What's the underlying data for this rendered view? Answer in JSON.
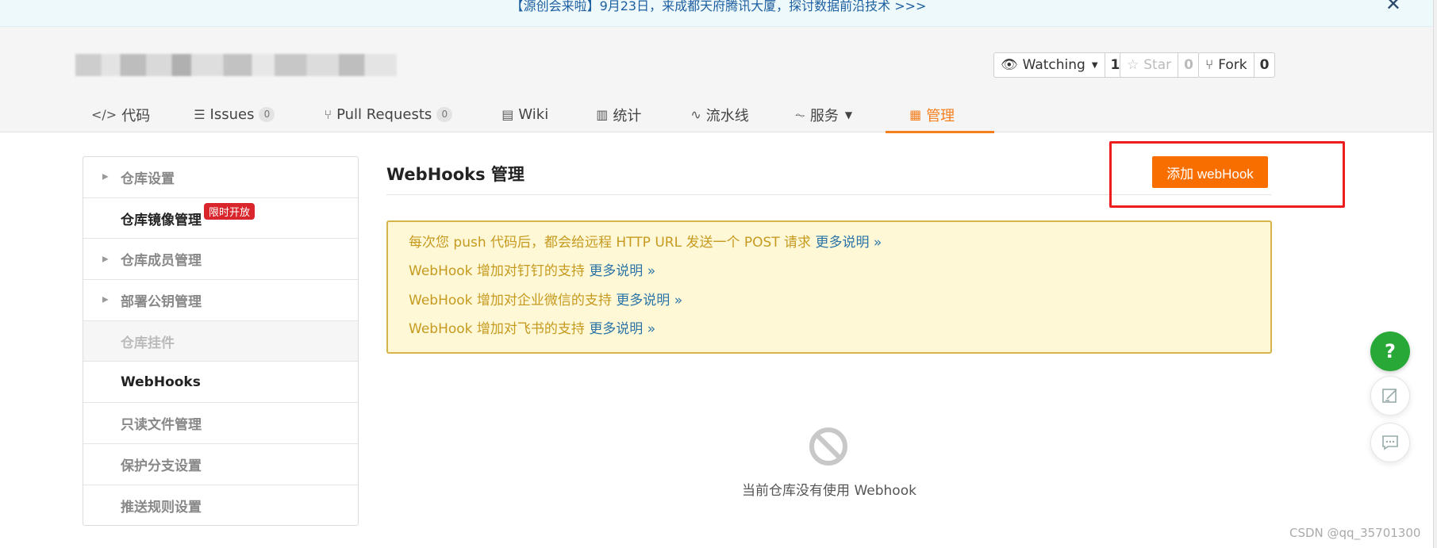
{
  "banner": {
    "text": "【源创会来啦】9月23日，来成都天府腾讯大厦，探讨数据前沿技术 >>>",
    "close_label": "✕"
  },
  "repo_actions": {
    "watch": {
      "label": "Watching",
      "count": "1"
    },
    "star": {
      "label": "Star",
      "count": "0"
    },
    "fork": {
      "label": "Fork",
      "count": "0"
    }
  },
  "tabs": [
    {
      "label": "代码",
      "icon": "</>"
    },
    {
      "label": "Issues",
      "icon": "☰",
      "badge": "0"
    },
    {
      "label": "Pull Requests",
      "icon": "⑂",
      "badge": "0"
    },
    {
      "label": "Wiki",
      "icon": "▤"
    },
    {
      "label": "统计",
      "icon": "▥"
    },
    {
      "label": "流水线",
      "icon": "∿"
    },
    {
      "label": "服务",
      "icon": "⏦"
    },
    {
      "label": "管理",
      "icon": "▦"
    }
  ],
  "sidebar": {
    "items": [
      {
        "label": "仓库设置"
      },
      {
        "label": "仓库镜像管理",
        "badge": "限时开放"
      },
      {
        "label": "仓库成员管理"
      },
      {
        "label": "部署公钥管理"
      },
      {
        "label": "仓库挂件"
      },
      {
        "label": "WebHooks"
      },
      {
        "label": "只读文件管理"
      },
      {
        "label": "保护分支设置"
      },
      {
        "label": "推送规则设置"
      }
    ]
  },
  "main": {
    "title": "WebHooks 管理",
    "add_button": "添加 webHook",
    "notices": [
      {
        "text": "每次您 push 代码后，都会给远程 HTTP URL 发送一个 POST 请求 ",
        "more": "更多说明 »"
      },
      {
        "text": "WebHook 增加对钉钉的支持 ",
        "more": "更多说明 »"
      },
      {
        "text": "WebHook 增加对企业微信的支持 ",
        "more": "更多说明 »"
      },
      {
        "text": "WebHook 增加对飞书的支持 ",
        "more": "更多说明 »"
      }
    ],
    "empty_text": "当前仓库没有使用 Webhook"
  },
  "floating": {
    "help_label": "?"
  },
  "watermark": "CSDN @qq_35701300",
  "colors": {
    "accent": "#f57e1d",
    "button": "#f86f00",
    "highlight_box": "#ee1c1c",
    "notice_bg": "#fff8d6",
    "help_green": "#27a837"
  }
}
